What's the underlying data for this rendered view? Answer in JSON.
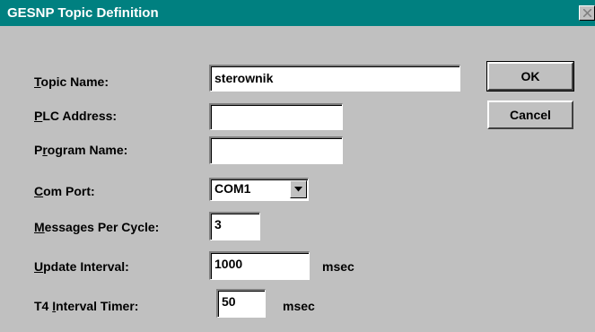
{
  "window": {
    "title": "GESNP Topic Definition",
    "close_icon": "close-icon"
  },
  "labels": {
    "topic_name": {
      "mnemonic": "T",
      "rest": "opic Name:"
    },
    "plc_address": {
      "mnemonic": "P",
      "rest": "LC Address:"
    },
    "program_name": {
      "before": "P",
      "mnemonic": "r",
      "rest": "ogram Name:"
    },
    "com_port": {
      "mnemonic": "C",
      "rest": "om Port:"
    },
    "messages_per_cycle": {
      "mnemonic": "M",
      "rest": "essages Per Cycle:"
    },
    "update_interval": {
      "mnemonic": "U",
      "rest": "pdate Interval:"
    },
    "t4_interval_timer": {
      "before": "T4 ",
      "mnemonic": "I",
      "rest": "nterval Timer:"
    }
  },
  "fields": {
    "topic_name": "sterownik",
    "plc_address": "",
    "program_name": "",
    "com_port": {
      "selected": "COM1",
      "arrow_icon": "chevron-down-icon"
    },
    "messages_per_cycle": "3",
    "update_interval": "1000",
    "t4_interval_timer": "50"
  },
  "units": {
    "update_interval": "msec",
    "t4_interval_timer": "msec"
  },
  "buttons": {
    "ok": "OK",
    "cancel": "Cancel"
  }
}
